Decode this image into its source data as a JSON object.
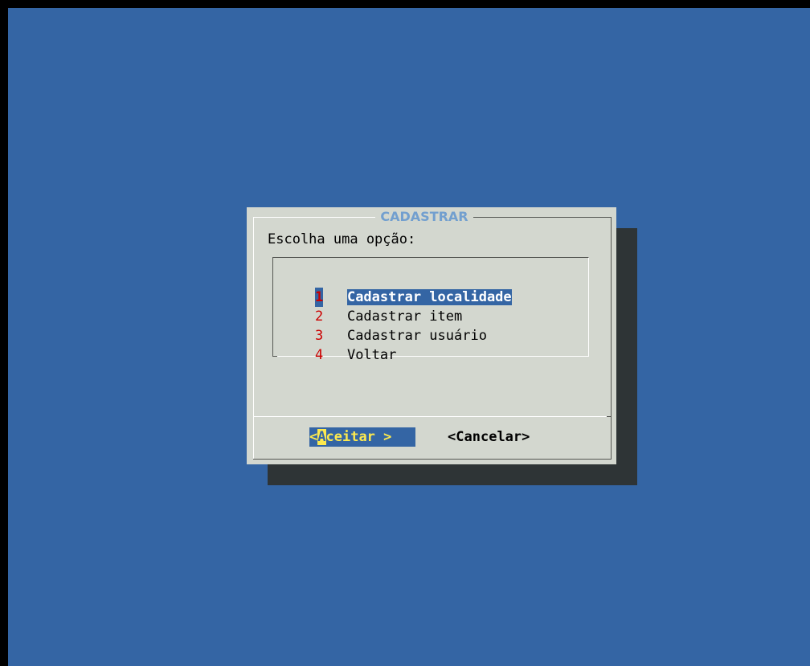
{
  "dialog": {
    "title": "CADASTRAR",
    "prompt": "Escolha uma opção:"
  },
  "menu": {
    "selected_index": 0,
    "items": [
      {
        "tag": "1",
        "label": "Cadastrar localidade"
      },
      {
        "tag": "2",
        "label": "Cadastrar item"
      },
      {
        "tag": "3",
        "label": "Cadastrar usuário"
      },
      {
        "tag": "4",
        "label": "Voltar"
      }
    ]
  },
  "buttons": {
    "accept": {
      "open": "<",
      "hotkey": "A",
      "rest": "ceitar",
      "close": " >"
    },
    "cancel": {
      "open": "<",
      "hotkey": "C",
      "rest": "ancelar",
      "close": ">"
    }
  },
  "colors": {
    "background": "#3465a4",
    "dialog": "#d3d7cf",
    "shadow": "#2e3436",
    "title": "#729fcf",
    "tag": "#cc0000",
    "highlight": "#fce94f"
  }
}
